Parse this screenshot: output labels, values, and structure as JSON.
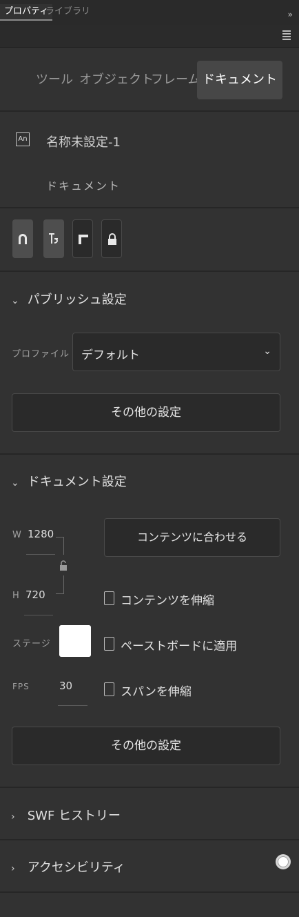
{
  "panel": {
    "collapse_glyph": "»",
    "tabs": [
      "プロパティ",
      "ライブラリ"
    ]
  },
  "modes": {
    "tool": "ツール",
    "object": "オブジェクト",
    "frame": "フレーム",
    "document": "ドキュメント"
  },
  "document": {
    "app_icon": "An",
    "name": "名称未設定-1",
    "type": "ドキュメント"
  },
  "icons": [
    "magnet-icon",
    "snap-guides-icon",
    "ruler-corner-icon",
    "lock-icon"
  ],
  "publish": {
    "chevron": "⌄",
    "title": "パブリッシュ設定",
    "profile_label": "プロファイル",
    "profile_value": "デフォルト",
    "more_settings": "その他の設定"
  },
  "docsettings": {
    "chevron": "⌄",
    "title": "ドキュメント設定",
    "w_label": "W",
    "w_value": "1280",
    "h_label": "H",
    "h_value": "720",
    "fit_button": "コンテンツに合わせる",
    "scale_content": "コンテンツを伸縮",
    "stage_label": "ステージ",
    "stage_color": "#FFFFFF",
    "apply_pasteboard": "ペーストボードに適用",
    "fps_label": "FPS",
    "fps_value": "30",
    "scale_spans": "スパンを伸縮",
    "more_settings": "その他の設定"
  },
  "swf_history": {
    "chevron": "›",
    "title": "SWF ヒストリー"
  },
  "accessibility": {
    "chevron": "›",
    "title": "アクセシビリティ"
  }
}
